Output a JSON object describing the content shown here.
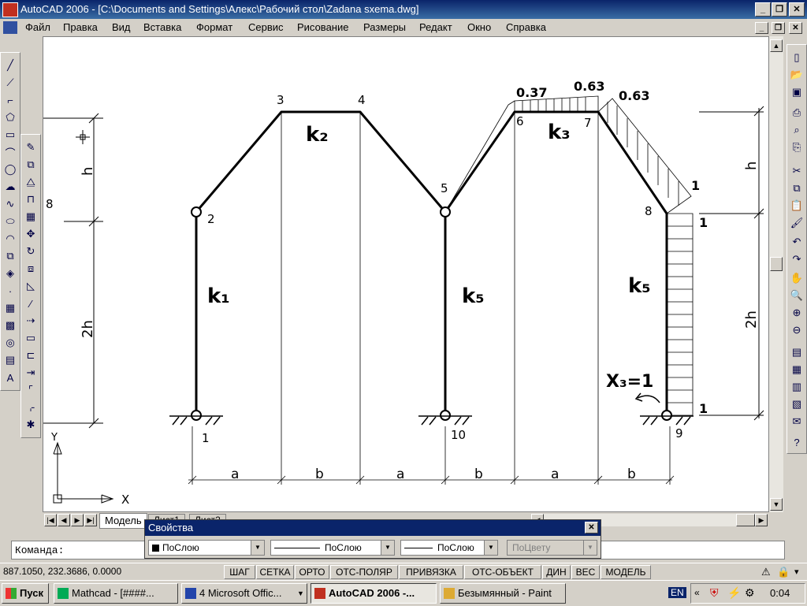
{
  "window": {
    "title": "AutoCAD 2006 - [C:\\Documents and Settings\\Алекс\\Рабочий стол\\Zadana sxema.dwg]"
  },
  "menu": {
    "items": [
      "Файл",
      "Правка",
      "Вид",
      "Вставка",
      "Формат",
      "Сервис",
      "Рисование",
      "Размеры",
      "Редакт",
      "Окно",
      "Справка"
    ]
  },
  "drawing": {
    "node_labels": [
      "1",
      "2",
      "3",
      "4",
      "5",
      "6",
      "7",
      "8",
      "9",
      "10"
    ],
    "node_label_left": "8",
    "stiffness_labels": [
      "k₁",
      "k₂",
      "k₅",
      "k₃",
      "k₅"
    ],
    "dimension_labels": [
      "a",
      "b",
      "a",
      "b",
      "a",
      "b"
    ],
    "height_labels_left": [
      "h",
      "2h"
    ],
    "height_labels_right": [
      "h",
      "2h"
    ],
    "moment_values": [
      "0.37",
      "0.63",
      "0.63",
      "1",
      "1",
      "1"
    ],
    "unknown_label": "X₃=1",
    "ucs_x": "X",
    "ucs_y": "Y"
  },
  "tabs": {
    "model": "Модель",
    "layout1": "Лист1",
    "layout2": "Лист2"
  },
  "command": {
    "label": "Команда:"
  },
  "properties": {
    "title": "Свойства",
    "color": "ПоСлою",
    "linetype": "ПоСлою",
    "lineweight": "ПоСлою",
    "plotstyle": "ПоЦвету"
  },
  "status": {
    "coords": "887.1050, 232.3686, 0.0000",
    "toggles": [
      "ШАГ",
      "СЕТКА",
      "ОРТО",
      "ОТС-ПОЛЯР",
      "ПРИВЯЗКА",
      "ОТС-ОБЪЕКТ",
      "ДИН",
      "ВЕС",
      "МОДЕЛЬ"
    ]
  },
  "taskbar": {
    "start": "Пуск",
    "tasks": [
      "Mathcad - [####...",
      "4 Microsoft Offic...",
      "AutoCAD 2006 -...",
      "Безымянный - Paint"
    ],
    "lang": "EN",
    "clock": "0:04"
  }
}
